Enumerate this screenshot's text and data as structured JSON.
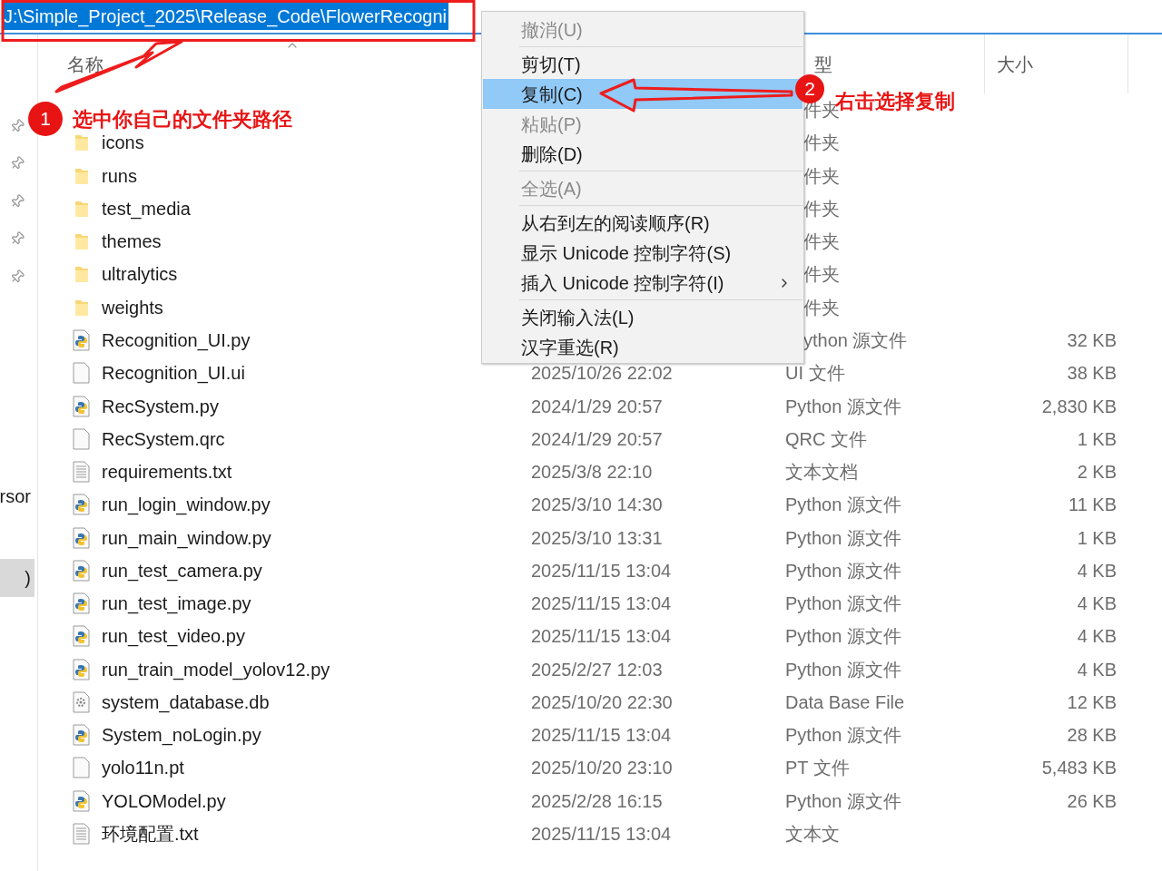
{
  "address_bar": {
    "path": "J:\\Simple_Project_2025\\Release_Code\\FlowerRecogni",
    "selected": true
  },
  "navigation_pane": {
    "items": [
      {
        "label": "rsor",
        "selected": false
      },
      {
        "label": ")",
        "selected": true
      }
    ]
  },
  "columns": [
    {
      "label": "名称",
      "sorted": true
    },
    {
      "label": "型",
      "sorted": false
    },
    {
      "label": "大小",
      "sorted": false
    }
  ],
  "files": [
    {
      "type": "件夹"
    },
    {
      "kind": "folder",
      "name": "icons",
      "type": "件夹"
    },
    {
      "kind": "folder",
      "name": "runs",
      "type": "件夹"
    },
    {
      "kind": "folder",
      "name": "test_media",
      "type": "件夹"
    },
    {
      "kind": "folder",
      "name": "themes",
      "type": "件夹"
    },
    {
      "kind": "folder",
      "name": "ultralytics",
      "type": "件夹"
    },
    {
      "kind": "folder",
      "name": "weights",
      "type": "件夹"
    },
    {
      "kind": "python",
      "name": "Recognition_UI.py",
      "type": "ython 源文件",
      "size": "32 KB"
    },
    {
      "kind": "file",
      "name": "Recognition_UI.ui",
      "date": "2025/10/26 22:02",
      "type": "UI 文件",
      "size": "38 KB"
    },
    {
      "kind": "python",
      "name": "RecSystem.py",
      "date": "2024/1/29 20:57",
      "type": "Python 源文件",
      "size": "2,830 KB"
    },
    {
      "kind": "file",
      "name": "RecSystem.qrc",
      "date": "2024/1/29 20:57",
      "type": "QRC 文件",
      "size": "1 KB"
    },
    {
      "kind": "text",
      "name": "requirements.txt",
      "date": "2025/3/8 22:10",
      "type": "文本文档",
      "size": "2 KB"
    },
    {
      "kind": "python",
      "name": "run_login_window.py",
      "date": "2025/3/10 14:30",
      "type": "Python 源文件",
      "size": "11 KB"
    },
    {
      "kind": "python",
      "name": "run_main_window.py",
      "date": "2025/3/10 13:31",
      "type": "Python 源文件",
      "size": "1 KB"
    },
    {
      "kind": "python",
      "name": "run_test_camera.py",
      "date": "2025/11/15 13:04",
      "type": "Python 源文件",
      "size": "4 KB"
    },
    {
      "kind": "python",
      "name": "run_test_image.py",
      "date": "2025/11/15 13:04",
      "type": "Python 源文件",
      "size": "4 KB"
    },
    {
      "kind": "python",
      "name": "run_test_video.py",
      "date": "2025/11/15 13:04",
      "type": "Python 源文件",
      "size": "4 KB"
    },
    {
      "kind": "python",
      "name": "run_train_model_yolov12.py",
      "date": "2025/2/27 12:03",
      "type": "Python 源文件",
      "size": "4 KB"
    },
    {
      "kind": "database",
      "name": "system_database.db",
      "date": "2025/10/20 22:30",
      "type": "Data Base File",
      "size": "12 KB"
    },
    {
      "kind": "python",
      "name": "System_noLogin.py",
      "date": "2025/11/15 13:04",
      "type": "Python 源文件",
      "size": "28 KB"
    },
    {
      "kind": "file",
      "name": "yolo11n.pt",
      "date": "2025/10/20 23:10",
      "type": "PT 文件",
      "size": "5,483 KB"
    },
    {
      "kind": "python",
      "name": "YOLOModel.py",
      "date": "2025/2/28 16:15",
      "type": "Python 源文件",
      "size": "26 KB"
    },
    {
      "kind": "text",
      "name": "环境配置.txt",
      "date": "2025/11/15 13:04",
      "type": "文本文"
    }
  ],
  "context_menu": {
    "items": [
      {
        "kind": "item",
        "label": "撤消(U)",
        "disabled": true,
        "selected": false,
        "submenu": false
      },
      {
        "kind": "separator"
      },
      {
        "kind": "item",
        "label": "剪切(T)",
        "disabled": false,
        "selected": false,
        "submenu": false
      },
      {
        "kind": "item",
        "label": "复制(C)",
        "disabled": false,
        "selected": true,
        "submenu": false
      },
      {
        "kind": "item",
        "label": "粘贴(P)",
        "disabled": true,
        "selected": false,
        "submenu": false
      },
      {
        "kind": "item",
        "label": "删除(D)",
        "disabled": false,
        "selected": false,
        "submenu": false
      },
      {
        "kind": "separator"
      },
      {
        "kind": "item",
        "label": "全选(A)",
        "disabled": true,
        "selected": false,
        "submenu": false
      },
      {
        "kind": "separator"
      },
      {
        "kind": "item",
        "label": "从右到左的阅读顺序(R)",
        "disabled": false,
        "selected": false,
        "submenu": false
      },
      {
        "kind": "item",
        "label": "显示 Unicode 控制字符(S)",
        "disabled": false,
        "selected": false,
        "submenu": false
      },
      {
        "kind": "item",
        "label": "插入 Unicode 控制字符(I)",
        "disabled": false,
        "selected": false,
        "submenu": true
      },
      {
        "kind": "separator"
      },
      {
        "kind": "item",
        "label": "关闭输入法(L)",
        "disabled": false,
        "selected": false,
        "submenu": false
      },
      {
        "kind": "item",
        "label": "汉字重选(R)",
        "disabled": false,
        "selected": false,
        "submenu": false
      }
    ]
  },
  "annotations": [
    {
      "number": "1",
      "text": "选中你自己的文件夹路径"
    },
    {
      "number": "2",
      "text": "右击选择复制"
    }
  ]
}
